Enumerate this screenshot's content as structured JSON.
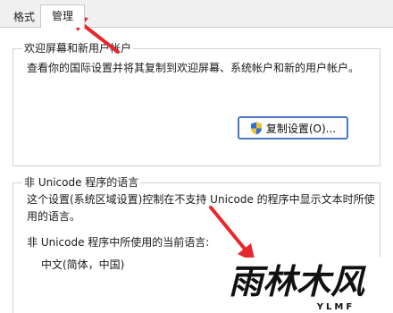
{
  "tabs": [
    {
      "label": "格式"
    },
    {
      "label": "管理"
    }
  ],
  "welcome_group": {
    "title": "欢迎屏幕和新用户帐户",
    "description": "查看你的国际设置并将其复制到欢迎屏幕、系统帐户和新的用户帐户。",
    "copy_button_label": "复制设置(O)..."
  },
  "unicode_group": {
    "title": "非 Unicode 程序的语言",
    "description_line1": "这个设置(系统区域设置)控制在不支持 Unicode 的程序中显示文本时所使",
    "description_line2": "用的语言。",
    "current_language_label": "非 Unicode 程序中所使用的当前语言:",
    "current_language_value": "中文(简体，中国)"
  },
  "watermark": {
    "logo": "雨林木风",
    "sub": "YLMF"
  },
  "colors": {
    "annotation_arrow": "#e8262d",
    "button_border": "#4a78c2"
  }
}
